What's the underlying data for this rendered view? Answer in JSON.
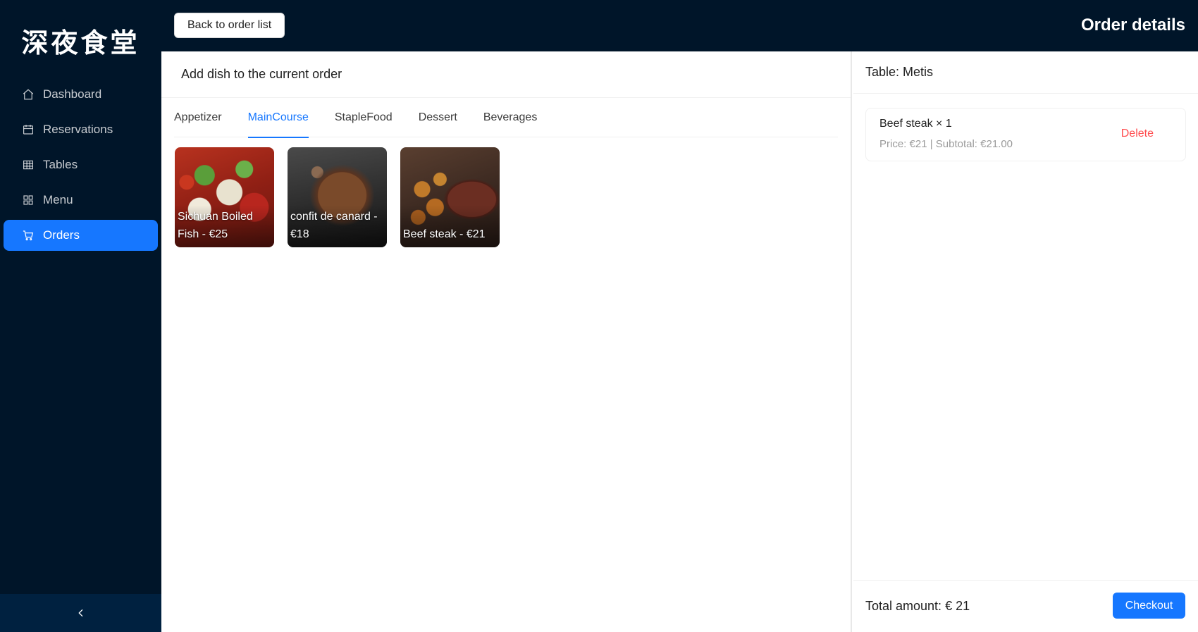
{
  "sidebar": {
    "logo": "深夜食堂",
    "items": [
      {
        "label": "Dashboard",
        "icon": "home-icon"
      },
      {
        "label": "Reservations",
        "icon": "calendar-icon"
      },
      {
        "label": "Tables",
        "icon": "table-icon"
      },
      {
        "label": "Menu",
        "icon": "grid-icon"
      },
      {
        "label": "Orders",
        "icon": "cart-icon",
        "active": true
      }
    ],
    "collapse_icon": "chevron-left-icon"
  },
  "header": {
    "back_label": "Back to order list",
    "title": "Order details"
  },
  "add_dish": {
    "title": "Add dish to the current order",
    "tabs": [
      "Appetizer",
      "MainCourse",
      "StapleFood",
      "Dessert",
      "Beverages"
    ],
    "active_tab": "MainCourse",
    "dishes": [
      {
        "label": "Sichuan Boiled Fish - €25"
      },
      {
        "label": "confit de canard - €18"
      },
      {
        "label": "Beef steak - €21"
      }
    ]
  },
  "order": {
    "table_label": "Table: Metis",
    "items": [
      {
        "name": "Beef steak × 1",
        "meta": "Price: €21 | Subtotal: €21.00",
        "delete_label": "Delete"
      }
    ],
    "total_label": "Total amount: € 21",
    "checkout_label": "Checkout"
  },
  "colors": {
    "sidebar_bg": "#001529",
    "accent": "#1677ff",
    "danger": "#ff4d4f"
  }
}
